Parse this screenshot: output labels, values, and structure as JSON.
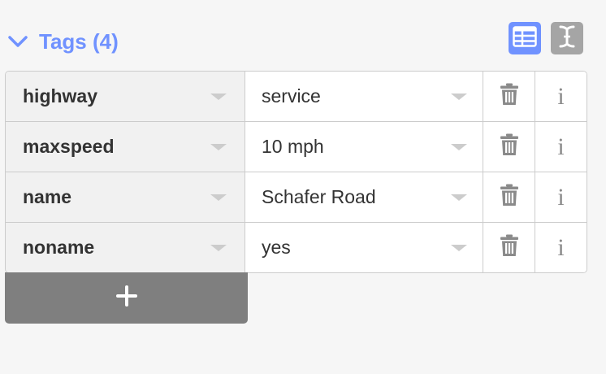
{
  "section": {
    "title": "Tags (4)"
  },
  "view_toggles": {
    "list_view_icon": "table-icon",
    "text_view_icon": "text-cursor-icon"
  },
  "tags": [
    {
      "key": "highway",
      "value": "service"
    },
    {
      "key": "maxspeed",
      "value": "10 mph"
    },
    {
      "key": "name",
      "value": "Schafer Road"
    },
    {
      "key": "noname",
      "value": "yes"
    }
  ],
  "row_actions": {
    "delete_icon": "trash-icon",
    "info_label": "i"
  },
  "add_button": {
    "icon": "plus-icon"
  },
  "colors": {
    "accent": "#7092ff",
    "inactive_button": "#a5a5a5",
    "add_button": "#7f7f7f",
    "border": "#cccccc",
    "key_background": "#f1f1f1"
  }
}
